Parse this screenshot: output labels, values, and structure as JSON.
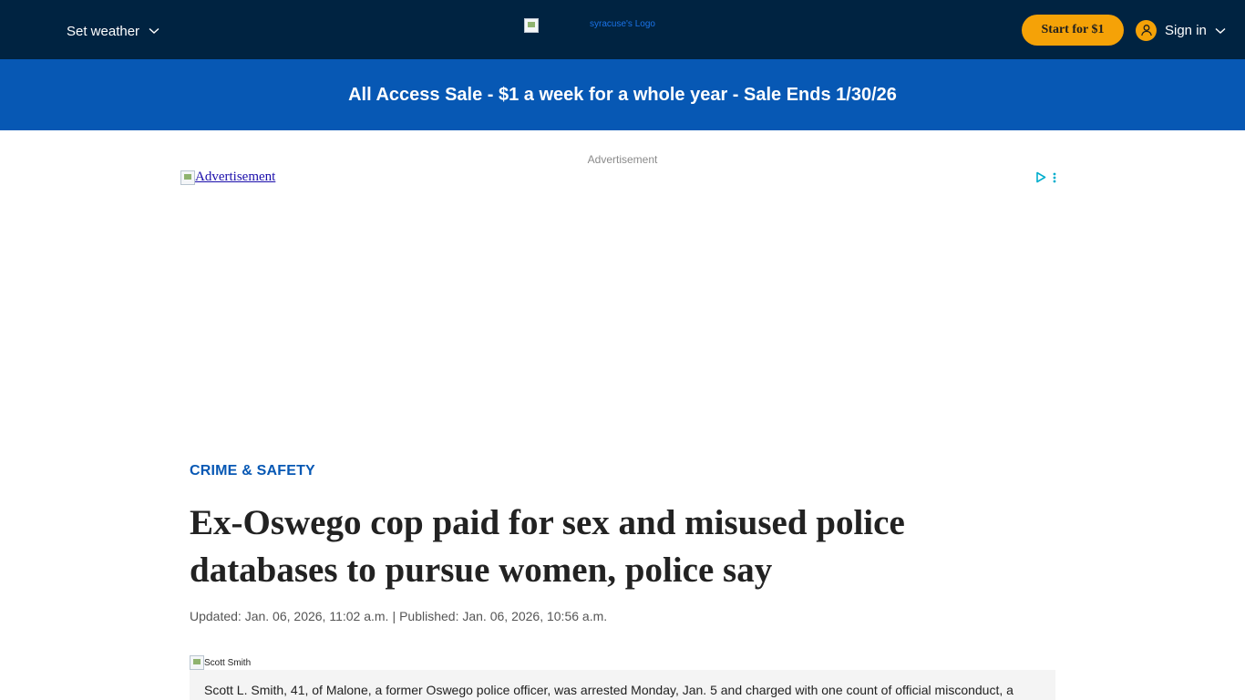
{
  "header": {
    "weather_label": "Set weather",
    "logo_alt": "syracuse's Logo",
    "start_button": "Start for $1",
    "signin_label": "Sign in"
  },
  "promo": {
    "text": "All Access Sale - $1 a week for a whole year - Sale Ends 1/30/26"
  },
  "ad": {
    "label": "Advertisement",
    "link_alt": "Advertisement"
  },
  "article": {
    "section": "CRIME & SAFETY",
    "headline": "Ex-Oswego cop paid for sex and misused police databases to pursue women, police say",
    "updated": "Updated: Jan. 06, 2026, 11:02 a.m.",
    "separator": "|",
    "published": "Published: Jan. 06, 2026, 10:56 a.m.",
    "photo_alt": "Scott Smith",
    "caption": "Scott L. Smith, 41, of Malone, a former Oswego police officer, was arrested Monday, Jan. 5 and charged with one count of official misconduct, a"
  },
  "colors": {
    "topbar": "#002341",
    "promo": "#0758b4",
    "accent_button": "#f5a207",
    "section_tag": "#0758b4"
  },
  "icons": {
    "weather": "chevron-down-icon",
    "signin": "user-icon",
    "adchoices": "adchoices-icon"
  }
}
